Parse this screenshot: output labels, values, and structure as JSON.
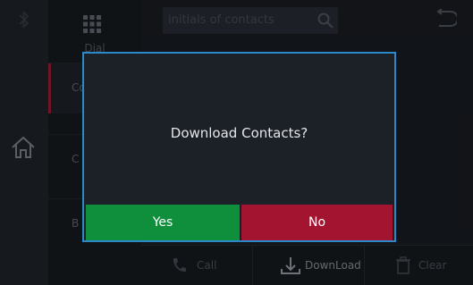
{
  "background_app": {
    "dial_label": "Dial",
    "menu_items": [
      {
        "label": "Co",
        "active": true
      },
      {
        "label": "C",
        "active": false
      },
      {
        "label": "B",
        "active": false
      }
    ],
    "search": {
      "placeholder": "initials of contacts"
    },
    "bottom_buttons": {
      "call": "Call",
      "download": "DownLoad",
      "clear": "Clear"
    },
    "icons": [
      "bluetooth-icon",
      "dialpad-grid-icon",
      "home-icon",
      "search-icon",
      "back-icon",
      "phone-icon",
      "download-icon",
      "trash-icon"
    ]
  },
  "dialog": {
    "message": "Download Contacts?",
    "yes_label": "Yes",
    "no_label": "No",
    "colors": {
      "border": "#2c88c8",
      "yes": "#0f8f3c",
      "no": "#a31431"
    }
  }
}
